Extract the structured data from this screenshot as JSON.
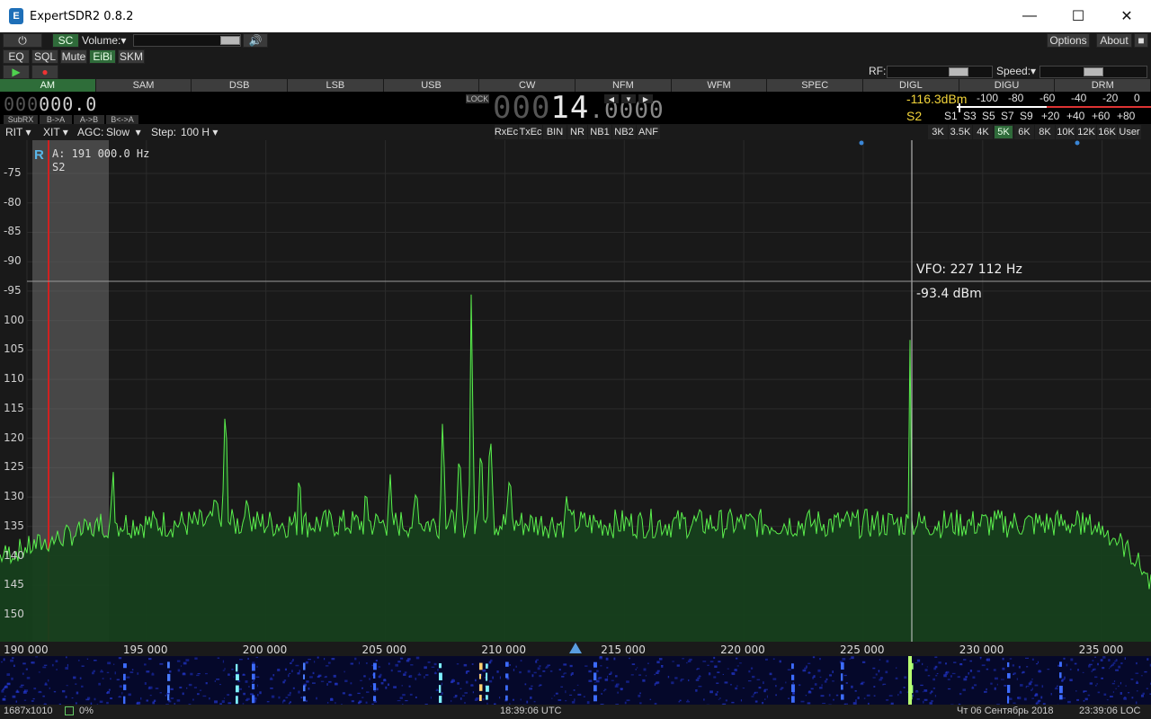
{
  "window": {
    "title": "ExpertSDR2 0.8.2",
    "icon": "E"
  },
  "toolbar1": {
    "power_icon": "power-icon",
    "sc_label": "SC",
    "volume_label": "Volume:",
    "volume_level": 0.9,
    "speaker_icon": "speaker-icon",
    "options_label": "Options",
    "about_label": "About"
  },
  "toolbar2": {
    "eq": "EQ",
    "sql": "SQL",
    "mute": "Mute",
    "eibi": "EiBi",
    "skm": "SKM"
  },
  "toolbar3": {
    "rf_label": "RF:",
    "speed_label": "Speed:",
    "rf_level": 0.72,
    "speed_level": 0.55
  },
  "modes": [
    "AM",
    "SAM",
    "DSB",
    "LSB",
    "USB",
    "CW",
    "NFM",
    "WFM",
    "SPEC",
    "DIGL",
    "DIGU",
    "DRM"
  ],
  "active_mode": "AM",
  "lcd": {
    "subrx_freq": "000.0",
    "subrx": "SubRX",
    "b_to_a": "B->A",
    "a_to_b": "A->B",
    "b_swap_a": "B<->A",
    "lock": "LOCK",
    "main_freq": "0.0.0.14.0.0.0.0",
    "smeter_dbm": "-116.3dBm",
    "smeter_s": "S2",
    "scale_top": [
      "-100",
      "-80",
      "-60",
      "-40",
      "-20",
      "0"
    ],
    "scale_bottom": [
      "S1",
      "S3",
      "S5",
      "S7",
      "S9",
      "+20",
      "+40",
      "+60",
      "+80"
    ]
  },
  "controls": {
    "rit": "RIT",
    "xit": "XIT",
    "agc_label": "AGC:",
    "agc_value": "Slow",
    "step_label": "Step:",
    "step_value": "100 H",
    "dsp": [
      "RxEc",
      "TxEc",
      "BIN",
      "NR",
      "NB1",
      "NB2",
      "ANF"
    ],
    "filters": [
      "3K",
      "3.5K",
      "4K",
      "5K",
      "6K",
      "8K",
      "10K",
      "12K",
      "16K",
      "User"
    ],
    "active_filter": "5K"
  },
  "spectrum": {
    "r_marker": "R",
    "a_freq": "A: 191 000.0 Hz",
    "a_s": "S2",
    "vfo": "VFO: 227 112 Hz",
    "cursor_level": "-93.4 dBm",
    "y_labels": [
      "-75",
      "-80",
      "-85",
      "-90",
      "-95",
      "100",
      "105",
      "110",
      "115",
      "120",
      "125",
      "130",
      "135",
      "140",
      "145",
      "150"
    ],
    "x_labels": [
      "190 000",
      "195 000",
      "200 000",
      "205 000",
      "210 000",
      "215 000",
      "220 000",
      "225 000",
      "230 000",
      "235 000"
    ],
    "line_color": "#5bef4d",
    "fill_color": "#163f1c"
  },
  "status": {
    "resolution": "1687x1010",
    "cpu": "0%",
    "utc": "18:39:06 UTC",
    "date": "Чт 06 Сентябрь 2018",
    "local": "23:39:06 LOC"
  }
}
